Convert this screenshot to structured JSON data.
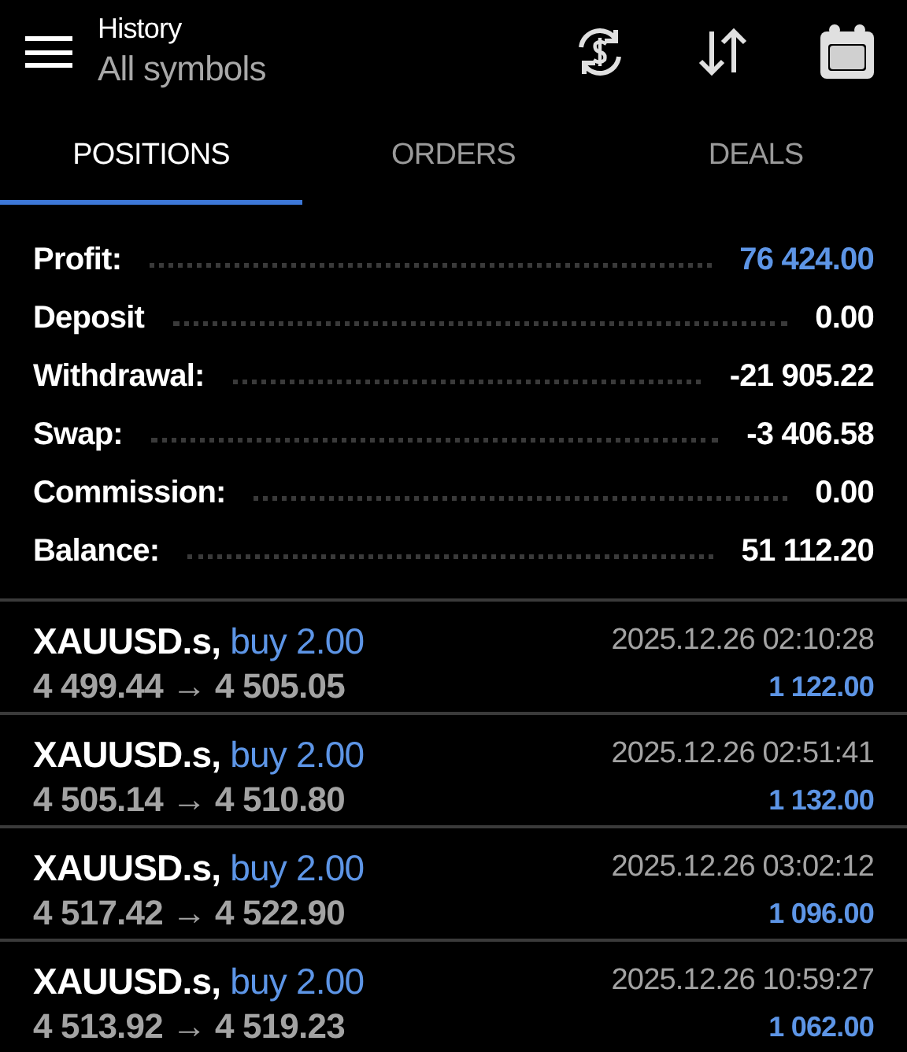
{
  "header": {
    "title": "History",
    "subtitle": "All symbols"
  },
  "tabs": [
    {
      "label": "POSITIONS",
      "selected": true
    },
    {
      "label": "ORDERS",
      "selected": false
    },
    {
      "label": "DEALS",
      "selected": false
    }
  ],
  "summary": [
    {
      "label": "Profit:",
      "value": "76 424.00",
      "highlighted": true
    },
    {
      "label": "Deposit",
      "value": "0.00",
      "highlighted": false
    },
    {
      "label": "Withdrawal:",
      "value": "-21 905.22",
      "highlighted": false
    },
    {
      "label": "Swap:",
      "value": "-3 406.58",
      "highlighted": false
    },
    {
      "label": "Commission:",
      "value": "0.00",
      "highlighted": false
    },
    {
      "label": "Balance:",
      "value": "51 112.20",
      "highlighted": false
    }
  ],
  "positions": [
    {
      "symbol": "XAUUSD.s,",
      "side": "buy",
      "volume": "2.00",
      "prices": "4 499.44 → 4 505.05",
      "time": "2025.12.26 02:10:28",
      "profit": "1 122.00"
    },
    {
      "symbol": "XAUUSD.s,",
      "side": "buy",
      "volume": "2.00",
      "prices": "4 505.14 → 4 510.80",
      "time": "2025.12.26 02:51:41",
      "profit": "1 132.00"
    },
    {
      "symbol": "XAUUSD.s,",
      "side": "buy",
      "volume": "2.00",
      "prices": "4 517.42 → 4 522.90",
      "time": "2025.12.26 03:02:12",
      "profit": "1 096.00"
    },
    {
      "symbol": "XAUUSD.s,",
      "side": "buy",
      "volume": "2.00",
      "prices": "4 513.92 → 4 519.23",
      "time": "2025.12.26 10:59:27",
      "profit": "1 062.00"
    }
  ]
}
